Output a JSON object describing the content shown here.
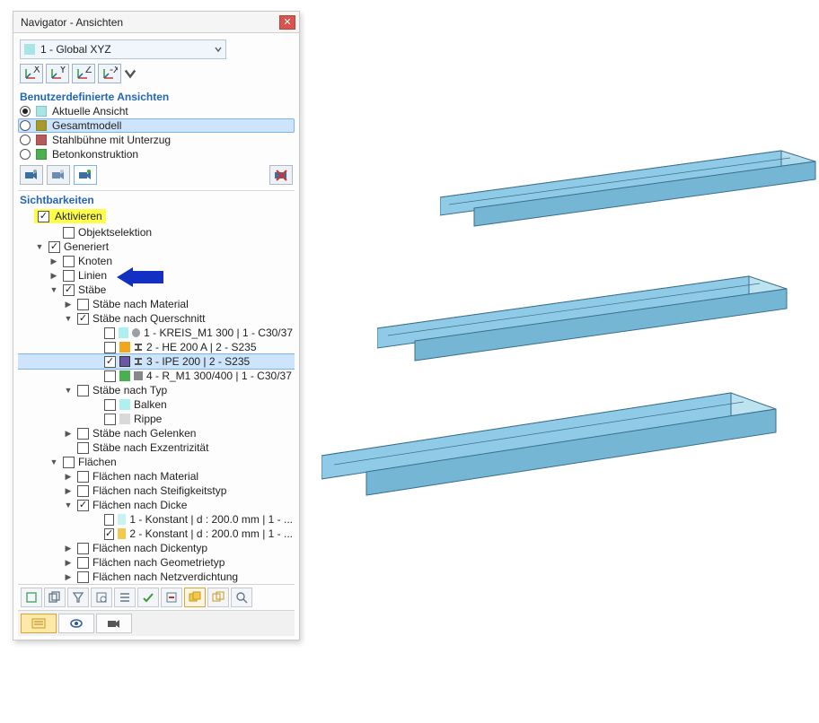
{
  "window": {
    "title": "Navigator - Ansichten"
  },
  "coord_dropdown": {
    "value": "1 - Global XYZ"
  },
  "axis_buttons": [
    "X",
    "Y",
    "Z",
    "-X"
  ],
  "sections": {
    "user_views": "Benutzerdefinierte Ansichten",
    "visibilities": "Sichtbarkeiten"
  },
  "radio_views": [
    {
      "label": "Aktuelle Ansicht",
      "color": "#a8e6e6",
      "checked": true,
      "selected": false
    },
    {
      "label": "Gesamtmodell",
      "color": "#a59a2b",
      "checked": false,
      "selected": true
    },
    {
      "label": "Stahlbühne mit Unterzug",
      "color": "#b65b5b",
      "checked": false,
      "selected": false
    },
    {
      "label": "Betonkonstruktion",
      "color": "#4bae4f",
      "checked": false,
      "selected": false
    }
  ],
  "activate": {
    "label": "Aktivieren",
    "checked": true
  },
  "tree": {
    "objektselektion": {
      "label": "Objektselektion",
      "checked": false
    },
    "generiert": {
      "label": "Generiert",
      "checked": true
    },
    "knoten": {
      "label": "Knoten",
      "checked": false
    },
    "linien": {
      "label": "Linien",
      "checked": false
    },
    "staebe": {
      "label": "Stäbe",
      "checked": true
    },
    "staebe_material": {
      "label": "Stäbe nach Material",
      "checked": false
    },
    "staebe_querschnitt": {
      "label": "Stäbe nach Querschnitt",
      "checked": true
    },
    "q1": {
      "label": "1 - KREIS_M1 300 | 1 - C30/37",
      "checked": false,
      "color": "#aef0f0",
      "icon": "circle"
    },
    "q2": {
      "label": "2 - HE 200 A | 2 - S235",
      "checked": false,
      "color": "#f2a61d",
      "icon": "ibeam"
    },
    "q3": {
      "label": "3 - IPE 200 | 2 - S235",
      "checked": true,
      "color": "#6a58a6",
      "icon": "ibeam",
      "selected": true
    },
    "q4": {
      "label": "4 - R_M1 300/400 | 1 - C30/37",
      "checked": false,
      "color": "#4bae4f",
      "icon": "rect"
    },
    "staebe_typ": {
      "label": "Stäbe nach Typ",
      "checked": false
    },
    "balken": {
      "label": "Balken",
      "checked": false,
      "color": "#aef0f0"
    },
    "rippe": {
      "label": "Rippe",
      "checked": false,
      "color": "#c9c9c9"
    },
    "staebe_gelenken": {
      "label": "Stäbe nach Gelenken",
      "checked": false
    },
    "staebe_exz": {
      "label": "Stäbe nach Exzentrizität",
      "checked": false
    },
    "flaechen": {
      "label": "Flächen",
      "checked": false
    },
    "f_material": {
      "label": "Flächen nach Material",
      "checked": false
    },
    "f_steif": {
      "label": "Flächen nach Steifigkeitstyp",
      "checked": false
    },
    "f_dicke": {
      "label": "Flächen nach Dicke",
      "checked": true
    },
    "d1": {
      "label": "1 - Konstant | d : 200.0 mm | 1 - ...",
      "checked": false,
      "color": "#c9f2f2"
    },
    "d2": {
      "label": "2 - Konstant | d : 200.0 mm | 1 - ...",
      "checked": true,
      "color": "#f2c94c"
    },
    "f_dickentyp": {
      "label": "Flächen nach Dickentyp",
      "checked": false
    },
    "f_geom": {
      "label": "Flächen nach Geometrietyp",
      "checked": false
    },
    "f_netz": {
      "label": "Flächen nach Netzverdichtung",
      "checked": false
    }
  },
  "colors": {
    "beam_fill": "#8fcbe6",
    "beam_top": "#bde2f0",
    "beam_edge": "#3a6f8e"
  }
}
